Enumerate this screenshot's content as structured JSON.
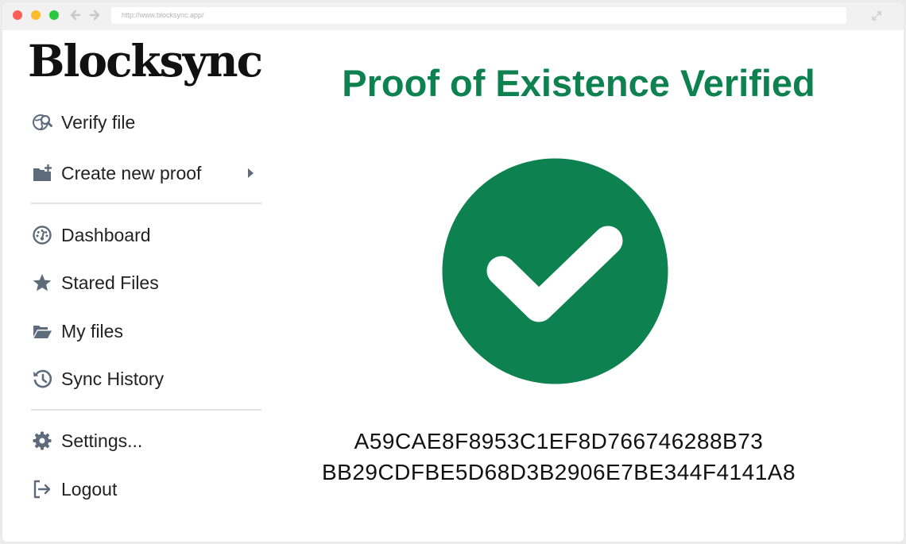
{
  "browser": {
    "url": "http://www.blocksync.app/"
  },
  "brand": {
    "name": "Blocksync"
  },
  "sidebar": {
    "items": [
      {
        "label": "Verify file",
        "icon": "globe-search-icon"
      },
      {
        "label": "Create new proof",
        "icon": "folder-plus-icon",
        "submenu": true
      },
      {
        "label": "Dashboard",
        "icon": "dashboard-gauge-icon"
      },
      {
        "label": "Stared Files",
        "icon": "star-icon"
      },
      {
        "label": "My files",
        "icon": "folder-open-icon"
      },
      {
        "label": "Sync History",
        "icon": "history-icon"
      },
      {
        "label": "Settings...",
        "icon": "gear-icon"
      },
      {
        "label": "Logout",
        "icon": "logout-icon"
      }
    ]
  },
  "main": {
    "title": "Proof of Existence Verified",
    "status_icon": "check-circle-icon",
    "hash_line_1": "A59CAE8F8953C1EF8D766746288B73",
    "hash_line_2": "BB29CDFBE5D68D3B2906E7BE344F4141A8"
  },
  "colors": {
    "accent": "#0e8150",
    "icon": "#5d6b7b",
    "text": "#222222"
  }
}
